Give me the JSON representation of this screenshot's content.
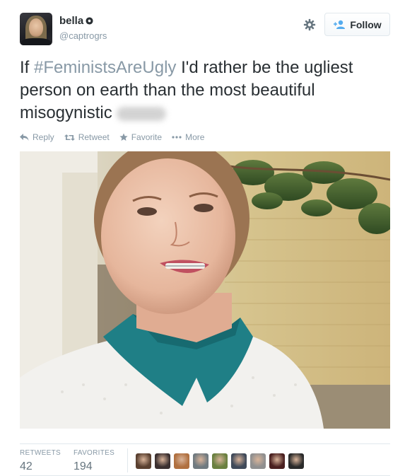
{
  "author": {
    "display_name": "bella",
    "handle": "@captrogrs",
    "avatar_icon": "user-avatar",
    "badge_icon": "flower-badge-icon"
  },
  "header": {
    "settings_icon": "gear-icon",
    "follow_label": "Follow",
    "follow_icon": "add-user-icon"
  },
  "tweet": {
    "text_before": "If ",
    "hashtag": "#FeministsAreUgly",
    "text_after": " I'd rather be the ugliest person on earth than the most beautiful misogynistic",
    "blurred_word": "prick",
    "hashtag_color": "#8899a6"
  },
  "actions": [
    {
      "label": "Reply",
      "icon": "reply-icon"
    },
    {
      "label": "Retweet",
      "icon": "retweet-icon"
    },
    {
      "label": "Favorite",
      "icon": "star-icon"
    },
    {
      "label": "More",
      "icon": "more-dots-icon"
    }
  ],
  "media": {
    "type": "photo",
    "subject": "selfie"
  },
  "stats": {
    "retweets_label": "RETWEETS",
    "retweets_value": "42",
    "favorites_label": "FAVORITES",
    "favorites_value": "194"
  },
  "favoriters": [
    {
      "color": "#5a4030"
    },
    {
      "color": "#3b3030"
    },
    {
      "color": "#b07040"
    },
    {
      "color": "#707a80"
    },
    {
      "color": "#6a8040"
    },
    {
      "color": "#404a5a"
    },
    {
      "color": "#909090"
    },
    {
      "color": "#4a2020"
    },
    {
      "color": "#2a2a2a"
    }
  ]
}
